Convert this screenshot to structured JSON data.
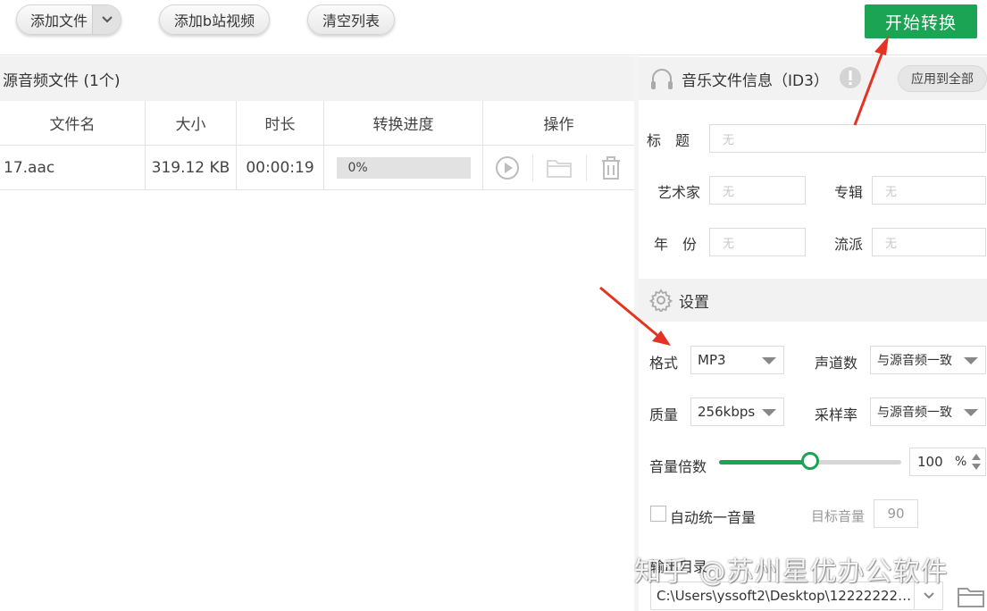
{
  "toolbar": {
    "add_file": "添加文件",
    "add_bili": "添加b站视频",
    "clear_list": "清空列表",
    "start": "开始转换"
  },
  "source": {
    "header": "源音频文件 (1个)",
    "columns": [
      "文件名",
      "大小",
      "时长",
      "转换进度",
      "操作"
    ],
    "rows": [
      {
        "name": "17.aac",
        "size": "319.12 KB",
        "duration": "00:00:19",
        "progress_text": "0%",
        "progress": 0
      }
    ]
  },
  "id3": {
    "title": "音乐文件信息（ID3）",
    "apply_all": "应用到全部",
    "title_label": "标　题",
    "artist_label": "艺术家",
    "album_label": "专辑",
    "year_label": "年　份",
    "genre_label": "流派",
    "placeholder": "无"
  },
  "settings": {
    "title": "设置",
    "format_label": "格式",
    "format_value": "MP3",
    "channels_label": "声道数",
    "channels_value": "与源音频一致",
    "quality_label": "质量",
    "quality_value": "256kbps",
    "samplerate_label": "采样率",
    "samplerate_value": "与源音频一致",
    "volume_label": "音量倍数",
    "volume_value": "100",
    "volume_unit": "%",
    "volume_level": 0.5,
    "normalize_label": "自动统一音量",
    "target_label": "目标音量",
    "target_value": "90",
    "output_label": "输出目录",
    "output_path": "C:\\Users\\yssoft2\\Desktop\\122222222..."
  },
  "watermark": "知乎 @苏州星优办公软件",
  "colors": {
    "accent": "#1aa453",
    "annotation": "#e53323"
  }
}
